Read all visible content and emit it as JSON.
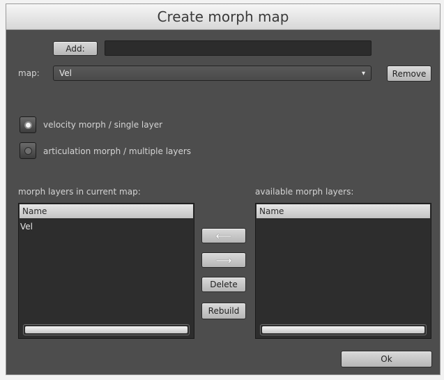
{
  "window": {
    "title": "Create morph map"
  },
  "add": {
    "button_label": "Add:",
    "name_value": ""
  },
  "map": {
    "label": "map:",
    "selected": "Vel",
    "caret": "▾",
    "remove_label": "Remove"
  },
  "morph_type": {
    "options": [
      {
        "label": "velocity morph / single layer",
        "selected": true
      },
      {
        "label": "articulation morph / multiple layers",
        "selected": false
      }
    ]
  },
  "current_layers": {
    "title": "morph layers in current map:",
    "column": "Name",
    "rows": [
      "Vel"
    ]
  },
  "available_layers": {
    "title": "available morph layers:",
    "column": "Name",
    "rows": []
  },
  "actions": {
    "move_left": "⟵",
    "move_right": "⟶",
    "delete": "Delete",
    "rebuild": "Rebuild"
  },
  "footer": {
    "ok_label": "Ok"
  }
}
